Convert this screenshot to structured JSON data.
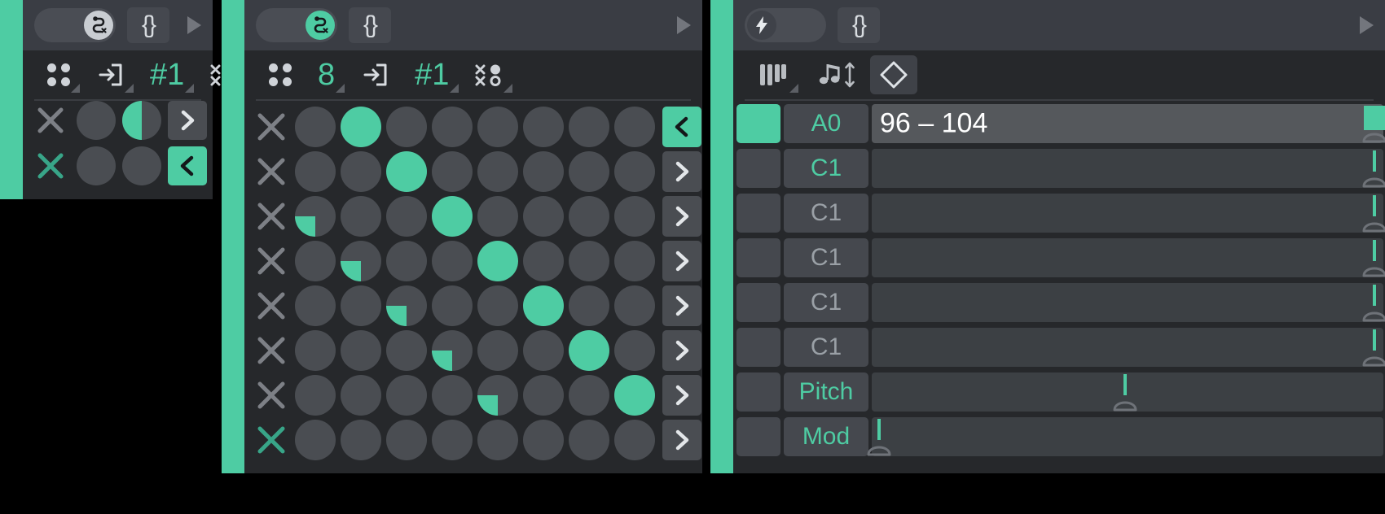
{
  "app": {
    "accent_color": "#4ecca3",
    "bg_color": "#000000",
    "panel_bg": "#26282b",
    "control_bg": "#4a4d52"
  },
  "left_panel": {
    "titlebar": {
      "toggle": {
        "state": "on",
        "icon": "snake-path-x-icon",
        "knob_color": "#c9cdd2"
      },
      "braces_label": "{}",
      "play_icon": "play-triangle-icon"
    },
    "toolstrip": {
      "tools": [
        {
          "icon": "four-dots-icon",
          "label": ""
        },
        {
          "icon": "enter-box-icon",
          "label": ""
        },
        {
          "icon": "",
          "label": "#1"
        },
        {
          "icon": "x-o-matrix-icon",
          "label": ""
        }
      ]
    },
    "rows": [
      {
        "clear_icon": "x-icon",
        "clear_active": false,
        "pads": [
          {
            "state": "off"
          },
          {
            "state": "half"
          }
        ],
        "arrow": {
          "icon": "chevron-right-icon",
          "active": false
        }
      },
      {
        "clear_icon": "x-icon",
        "clear_active": true,
        "pads": [
          {
            "state": "off"
          },
          {
            "state": "off"
          }
        ],
        "arrow": {
          "icon": "chevron-left-icon",
          "active": true
        }
      }
    ]
  },
  "middle_panel": {
    "titlebar": {
      "toggle": {
        "state": "on",
        "icon": "snake-path-x-icon",
        "knob_color": "#4ecca3"
      },
      "braces_label": "{}",
      "play_icon": "play-triangle-icon"
    },
    "toolstrip": {
      "tools": [
        {
          "icon": "four-dots-icon",
          "label": ""
        },
        {
          "icon": "",
          "label": "8"
        },
        {
          "icon": "enter-box-icon",
          "label": ""
        },
        {
          "icon": "",
          "label": "#1"
        },
        {
          "icon": "x-o-matrix-icon",
          "label": ""
        }
      ]
    },
    "step_count": 8,
    "rows": [
      {
        "clear_active": false,
        "steps": [
          "off",
          "on",
          "off",
          "off",
          "off",
          "off",
          "off",
          "off"
        ],
        "arrow": "chevron-left-icon",
        "arrow_active": true
      },
      {
        "clear_active": false,
        "steps": [
          "off",
          "off",
          "on",
          "off",
          "off",
          "off",
          "off",
          "off"
        ],
        "arrow": "chevron-right-icon",
        "arrow_active": false
      },
      {
        "clear_active": false,
        "steps": [
          "quarter",
          "off",
          "off",
          "on",
          "off",
          "off",
          "off",
          "off"
        ],
        "arrow": "chevron-right-icon",
        "arrow_active": false
      },
      {
        "clear_active": false,
        "steps": [
          "off",
          "quarter",
          "off",
          "off",
          "on",
          "off",
          "off",
          "off"
        ],
        "arrow": "chevron-right-icon",
        "arrow_active": false
      },
      {
        "clear_active": false,
        "steps": [
          "off",
          "off",
          "quarter",
          "off",
          "off",
          "on",
          "off",
          "off"
        ],
        "arrow": "chevron-right-icon",
        "arrow_active": false
      },
      {
        "clear_active": false,
        "steps": [
          "off",
          "off",
          "off",
          "quarter",
          "off",
          "off",
          "on",
          "off"
        ],
        "arrow": "chevron-right-icon",
        "arrow_active": false
      },
      {
        "clear_active": false,
        "steps": [
          "off",
          "off",
          "off",
          "off",
          "quarter",
          "off",
          "off",
          "on"
        ],
        "arrow": "chevron-right-icon",
        "arrow_active": false
      },
      {
        "clear_active": true,
        "steps": [
          "off",
          "off",
          "off",
          "off",
          "off",
          "off",
          "off",
          "off"
        ],
        "arrow": "chevron-right-icon",
        "arrow_active": false
      }
    ]
  },
  "right_panel": {
    "titlebar": {
      "toggle": {
        "state": "off",
        "icon": "lightning-bolt-icon",
        "knob_color": "#3f4249"
      },
      "braces_label": "{}",
      "play_icon": "play-triangle-icon"
    },
    "toolstrip": {
      "tools": [
        {
          "icon": "piano-keys-icon",
          "label": ""
        },
        {
          "icon": "note-updown-icon",
          "label": ""
        },
        {
          "icon": "diamond-icon",
          "label": "",
          "boxed": true
        }
      ]
    },
    "lanes": [
      {
        "enabled": true,
        "name": "A0",
        "name_green": true,
        "value": "96 – 104",
        "handle_pct": 98.2,
        "handle_flag": true,
        "track_filled": true
      },
      {
        "enabled": false,
        "name": "C1",
        "name_green": true,
        "value": "",
        "handle_pct": 98.2,
        "handle_flag": false,
        "track_filled": false
      },
      {
        "enabled": false,
        "name": "C1",
        "name_green": false,
        "value": "",
        "handle_pct": 98.2,
        "handle_flag": false,
        "track_filled": false
      },
      {
        "enabled": false,
        "name": "C1",
        "name_green": false,
        "value": "",
        "handle_pct": 98.2,
        "handle_flag": false,
        "track_filled": false
      },
      {
        "enabled": false,
        "name": "C1",
        "name_green": false,
        "value": "",
        "handle_pct": 98.2,
        "handle_flag": false,
        "track_filled": false
      },
      {
        "enabled": false,
        "name": "C1",
        "name_green": false,
        "value": "",
        "handle_pct": 98.2,
        "handle_flag": false,
        "track_filled": false
      },
      {
        "enabled": false,
        "name": "Pitch",
        "name_green": true,
        "value": "",
        "handle_pct": 49.5,
        "handle_flag": false,
        "track_filled": false
      },
      {
        "enabled": false,
        "name": "Mod",
        "name_green": true,
        "value": "",
        "handle_pct": 1.5,
        "handle_flag": false,
        "track_filled": false
      }
    ]
  }
}
